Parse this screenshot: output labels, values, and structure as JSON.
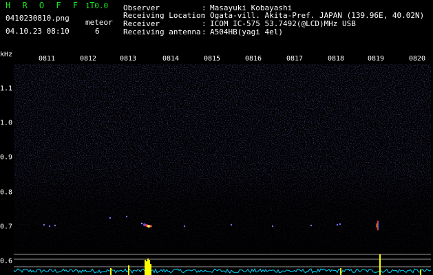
{
  "header": {
    "title": "H R O F F T",
    "version": "1.0.0",
    "filename": "0410230810.png",
    "meteor_label": "meteor",
    "datetime": "04.10.23 08:10",
    "meteor_count": "6"
  },
  "info": [
    {
      "label": "Observer",
      "value": "Masayuki Kobayashi"
    },
    {
      "label": "Receiving Location",
      "value": "Ogata-vill. Akita-Pref. JAPAN (139.96E, 40.02N)"
    },
    {
      "label": "Receiver",
      "value": "ICOM IC-575 53.7492(@LCD)MHz USB"
    },
    {
      "label": "Receiving antenna",
      "value": "A504HB(yagi 4el)"
    }
  ],
  "spectrogram": {
    "freq_unit": "kHz",
    "time_ticks": [
      "0811",
      "0812",
      "0813",
      "0814",
      "0815",
      "0816",
      "0817",
      "0818",
      "0819",
      "0820"
    ],
    "freq_ticks": [
      "1.1",
      "1.0",
      "0.9",
      "0.8",
      "0.7",
      "0.6"
    ],
    "colors": {
      "background": "#000000",
      "noise": "#2a2a9a",
      "header_green": "#1fe61f",
      "spectrum_line": "#00d8ff",
      "spectrum_peak": "#ffff00"
    }
  },
  "chart_data": {
    "type": "heatmap",
    "x_ticks": [
      "0811",
      "0812",
      "0813",
      "0814",
      "0815",
      "0816",
      "0817",
      "0818",
      "0819",
      "0820"
    ],
    "y_ticks": [
      1.1,
      1.0,
      0.9,
      0.8,
      0.7,
      0.6
    ],
    "ylabel": "kHz",
    "meteor_echoes": [
      {
        "time": "0813.5",
        "freq_khz": 0.7
      },
      {
        "time": "0819.5",
        "freq_khz": 0.7
      }
    ]
  }
}
